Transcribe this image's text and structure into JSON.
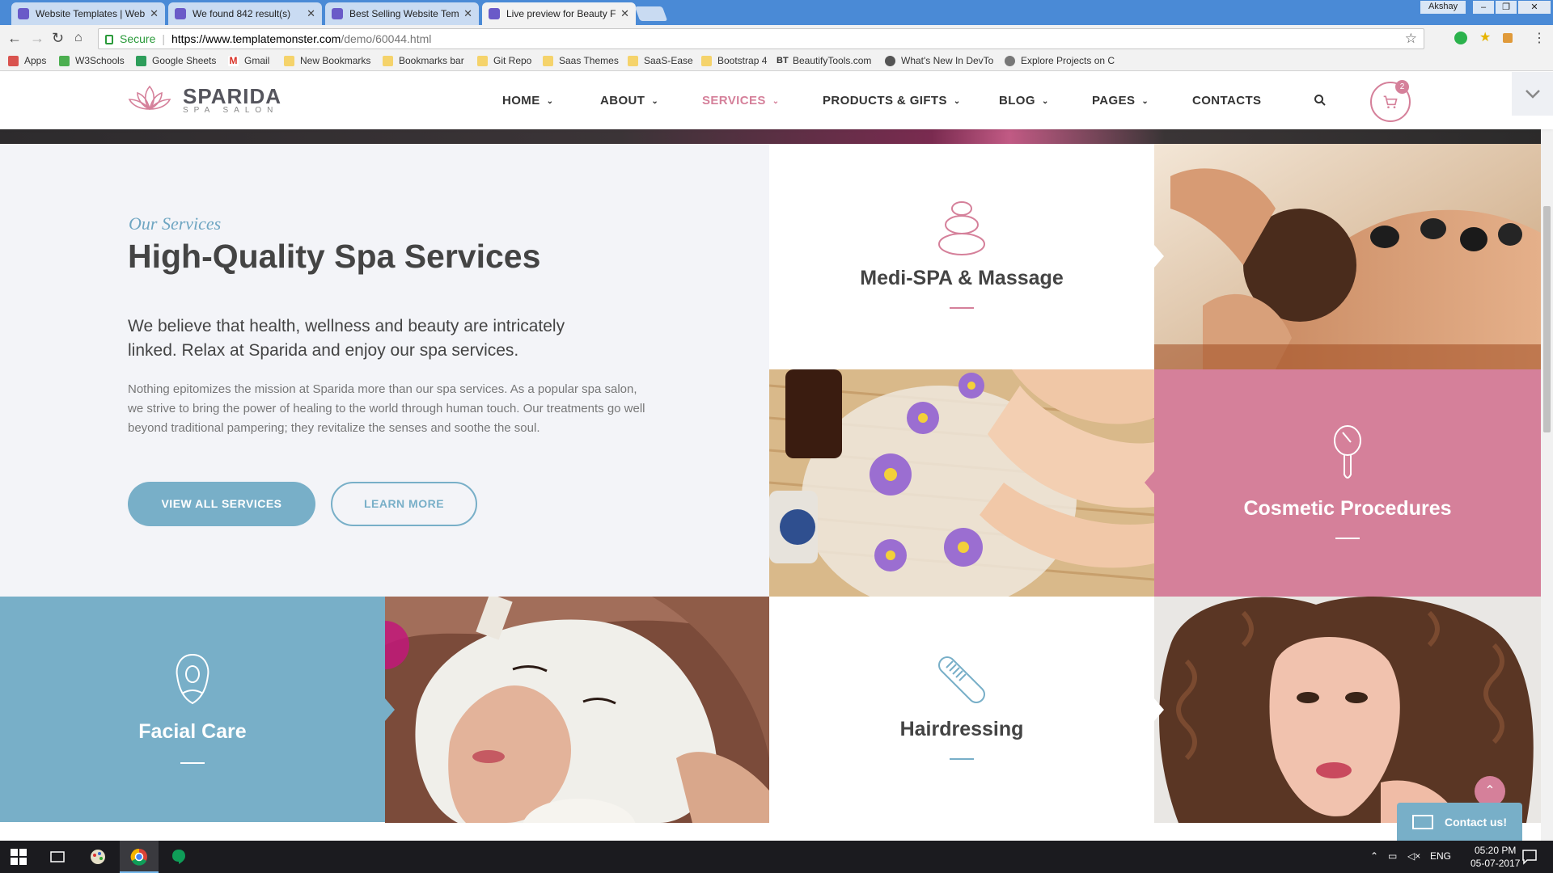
{
  "browser": {
    "tabs": [
      {
        "title": "Website Templates | Web",
        "active": false
      },
      {
        "title": "We found 842 result(s)",
        "active": false
      },
      {
        "title": "Best Selling Website Tem",
        "active": false
      },
      {
        "title": "Live preview for Beauty F",
        "active": true
      }
    ],
    "user": "Akshay",
    "address": {
      "secure_label": "Secure",
      "url_host": "https://www.templatemonster.com",
      "url_path": "/demo/60044.html"
    },
    "bookmarks": [
      "Apps",
      "W3Schools",
      "Google Sheets",
      "Gmail",
      "New Bookmarks",
      "Bookmarks bar",
      "Git Repo",
      "Saas Themes",
      "SaaS-Ease",
      "Bootstrap 4",
      "BeautifyTools.com",
      "What's New In DevTo",
      "Explore Projects on C"
    ]
  },
  "site": {
    "logo": {
      "name": "SPARIDA",
      "sub": "SPA SALON"
    },
    "nav": [
      {
        "label": "HOME",
        "dropdown": true,
        "active": false
      },
      {
        "label": "ABOUT",
        "dropdown": true,
        "active": false
      },
      {
        "label": "SERVICES",
        "dropdown": true,
        "active": true
      },
      {
        "label": "PRODUCTS & GIFTS",
        "dropdown": true,
        "active": false
      },
      {
        "label": "BLOG",
        "dropdown": true,
        "active": false
      },
      {
        "label": "PAGES",
        "dropdown": true,
        "active": false
      },
      {
        "label": "CONTACTS",
        "dropdown": false,
        "active": false
      }
    ],
    "cart_count": "2",
    "colors": {
      "accent_pink": "#d5809a",
      "accent_blue": "#78afc8",
      "text_dark": "#444444"
    }
  },
  "services": {
    "eyebrow": "Our Services",
    "headline": "High-Quality Spa Services",
    "lead": "We believe that health, wellness and beauty are intricately linked. Relax at Sparida and enjoy our spa services.",
    "body": "Nothing epitomizes the mission at Sparida more than our spa services. As a popular spa salon, we strive to bring the power of healing to the world through human touch. Our treatments go well beyond traditional pampering; they revitalize the senses and soothe the soul.",
    "primary_button": "VIEW ALL SERVICES",
    "secondary_button": "LEARN MORE",
    "tiles": [
      {
        "title": "Medi-SPA & Massage",
        "icon": "stones-icon"
      },
      {
        "title": "Cosmetic Procedures",
        "icon": "mirror-icon"
      },
      {
        "title": "Facial Care",
        "icon": "face-icon"
      },
      {
        "title": "Hairdressing",
        "icon": "comb-icon"
      }
    ]
  },
  "widgets": {
    "contact_label": "Contact us!"
  },
  "taskbar": {
    "lang": "ENG",
    "time": "05:20 PM",
    "date": "05-07-2017"
  }
}
